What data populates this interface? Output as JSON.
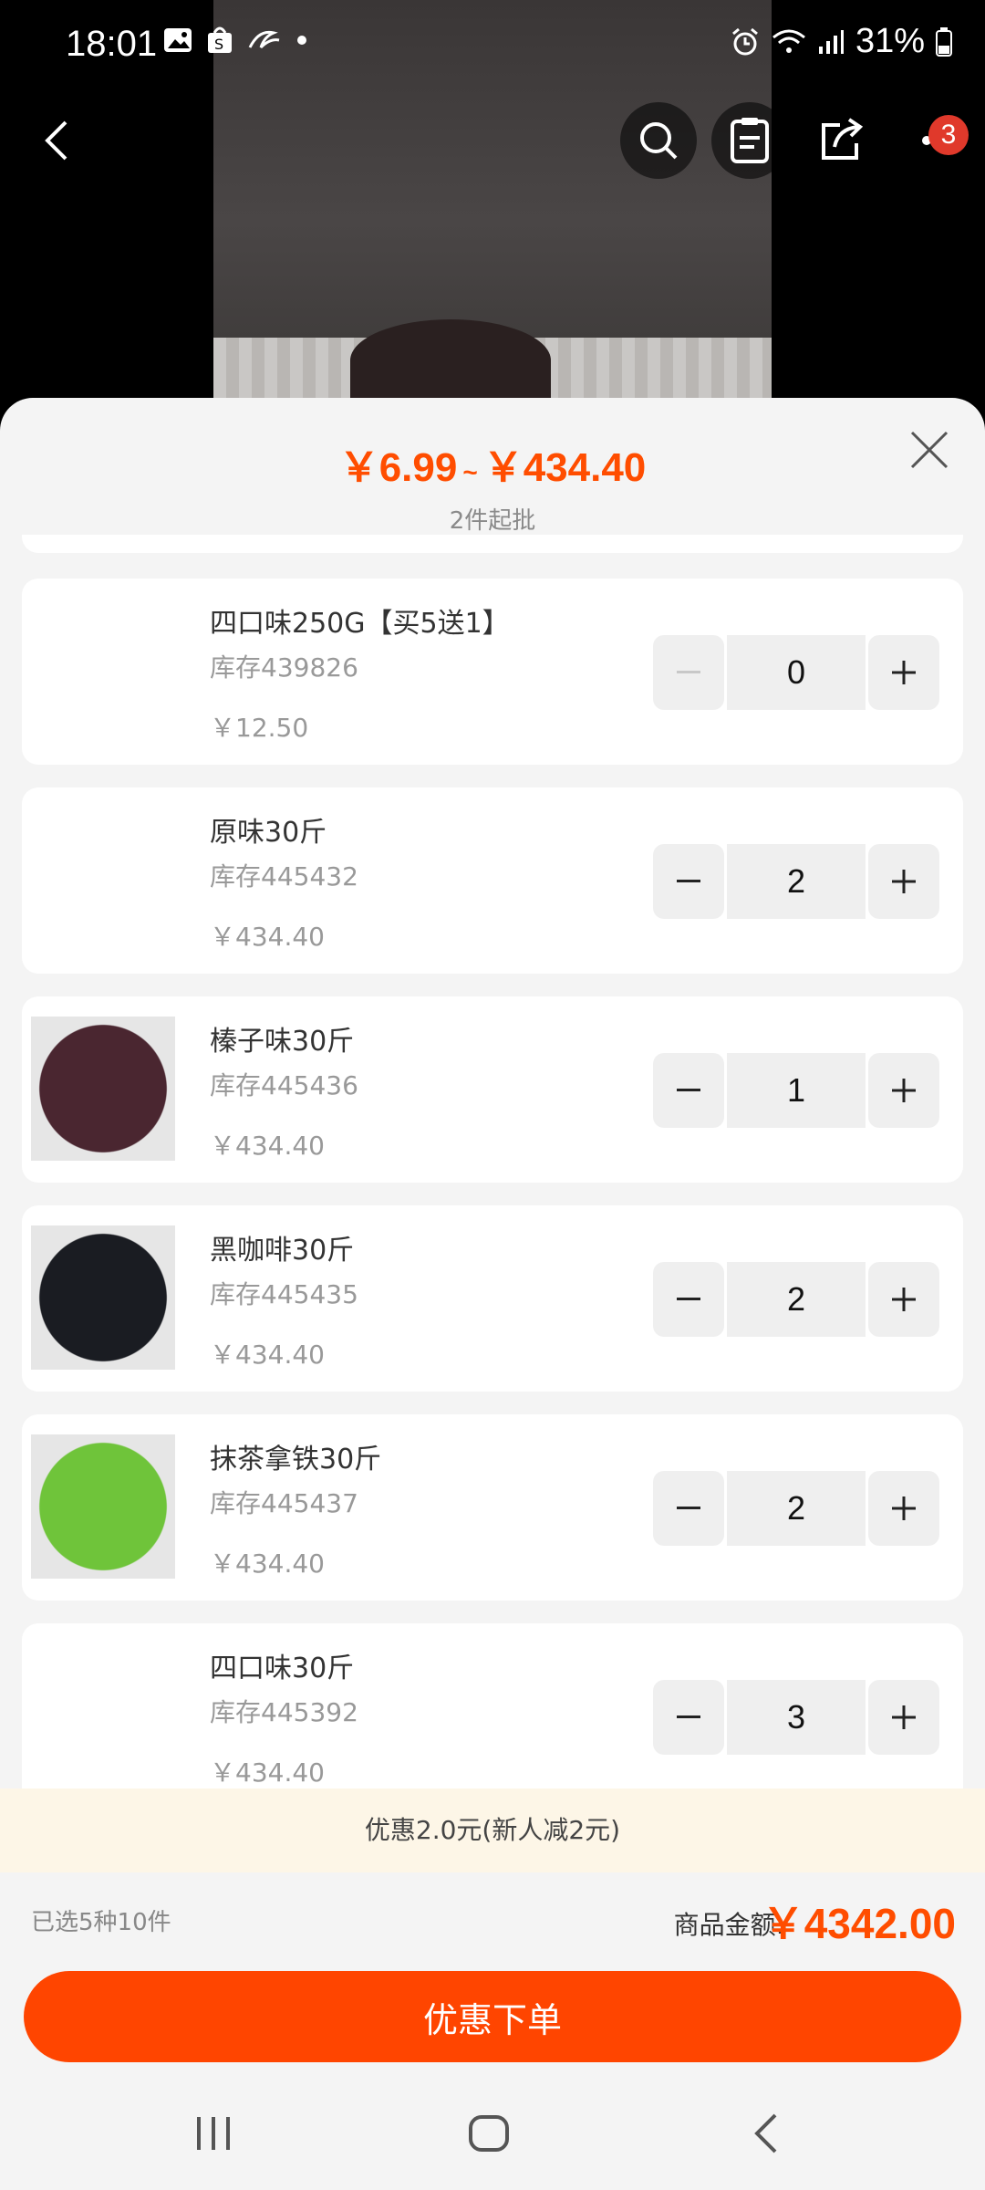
{
  "status": {
    "time": "18:01",
    "battery": "31%"
  },
  "nav": {
    "cart_count": "3"
  },
  "sheet": {
    "price_min": "￥6.99",
    "price_separator": "~",
    "price_max": "￥434.40",
    "moq": "2件起批"
  },
  "items": [
    {
      "name": "四口味250G【买5送1】",
      "stock": "库存439826",
      "price": "￥12.50",
      "qty": "0",
      "thumb": "none"
    },
    {
      "name": "原味30斤",
      "stock": "库存445432",
      "price": "￥434.40",
      "qty": "2",
      "thumb": "none"
    },
    {
      "name": "榛子味30斤",
      "stock": "库存445436",
      "price": "￥434.40",
      "qty": "1",
      "thumb": "#4a2630"
    },
    {
      "name": "黑咖啡30斤",
      "stock": "库存445435",
      "price": "￥434.40",
      "qty": "2",
      "thumb": "#1a1c22"
    },
    {
      "name": "抹茶拿铁30斤",
      "stock": "库存445437",
      "price": "￥434.40",
      "qty": "2",
      "thumb": "#6fc43a"
    },
    {
      "name": "四口味30斤",
      "stock": "库存445392",
      "price": "￥434.40",
      "qty": "3",
      "thumb": "none"
    }
  ],
  "promo": "优惠2.0元(新人减2元)",
  "summary": {
    "selected": "已选5种10件",
    "total_label": "商品金额:",
    "total_value": "￥4342.00"
  },
  "order_button": "优惠下单",
  "colors": {
    "accent": "#ff4d00",
    "button": "#ff4500",
    "badge": "#e0392b"
  }
}
